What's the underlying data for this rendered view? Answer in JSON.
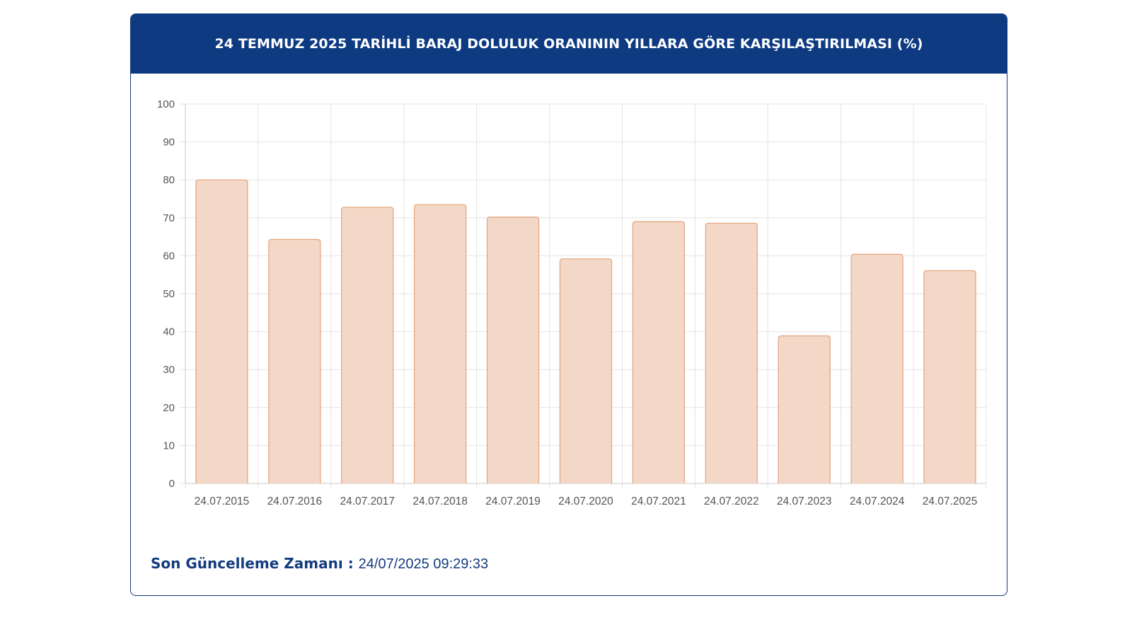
{
  "card": {
    "title": "24 TEMMUZ 2025 TARİHLİ BARAJ DOLULUK ORANININ YILLARA GÖRE KARŞILAŞTIRILMASI (%)"
  },
  "footer": {
    "label": "Son Güncelleme Zamanı",
    "separator": " : ",
    "value": "24/07/2025 09:29:33"
  },
  "chart_data": {
    "type": "bar",
    "title": "24 TEMMUZ 2025 TARİHLİ BARAJ DOLULUK ORANININ YILLARA GÖRE KARŞILAŞTIRILMASI (%)",
    "categories": [
      "24.07.2015",
      "24.07.2016",
      "24.07.2017",
      "24.07.2018",
      "24.07.2019",
      "24.07.2020",
      "24.07.2021",
      "24.07.2022",
      "24.07.2023",
      "24.07.2024",
      "24.07.2025"
    ],
    "values": [
      80.0,
      64.3,
      72.8,
      73.5,
      70.2,
      59.2,
      69.0,
      68.6,
      38.9,
      60.4,
      56.1
    ],
    "yticks": [
      0,
      10,
      20,
      30,
      40,
      50,
      60,
      70,
      80,
      90,
      100
    ],
    "ylim": [
      0,
      100
    ],
    "xlabel": "",
    "ylabel": "",
    "grid": true,
    "legend": "none",
    "bar_fill": "#f3d8c7",
    "bar_stroke": "#e2a47c",
    "grid_color": "#e4e4e4",
    "axis_color": "#c8c8c8",
    "tick_color": "#555555"
  },
  "colors": {
    "header_bg": "#0e3a82",
    "border": "#143b7e",
    "footer_text": "#143b7e"
  }
}
